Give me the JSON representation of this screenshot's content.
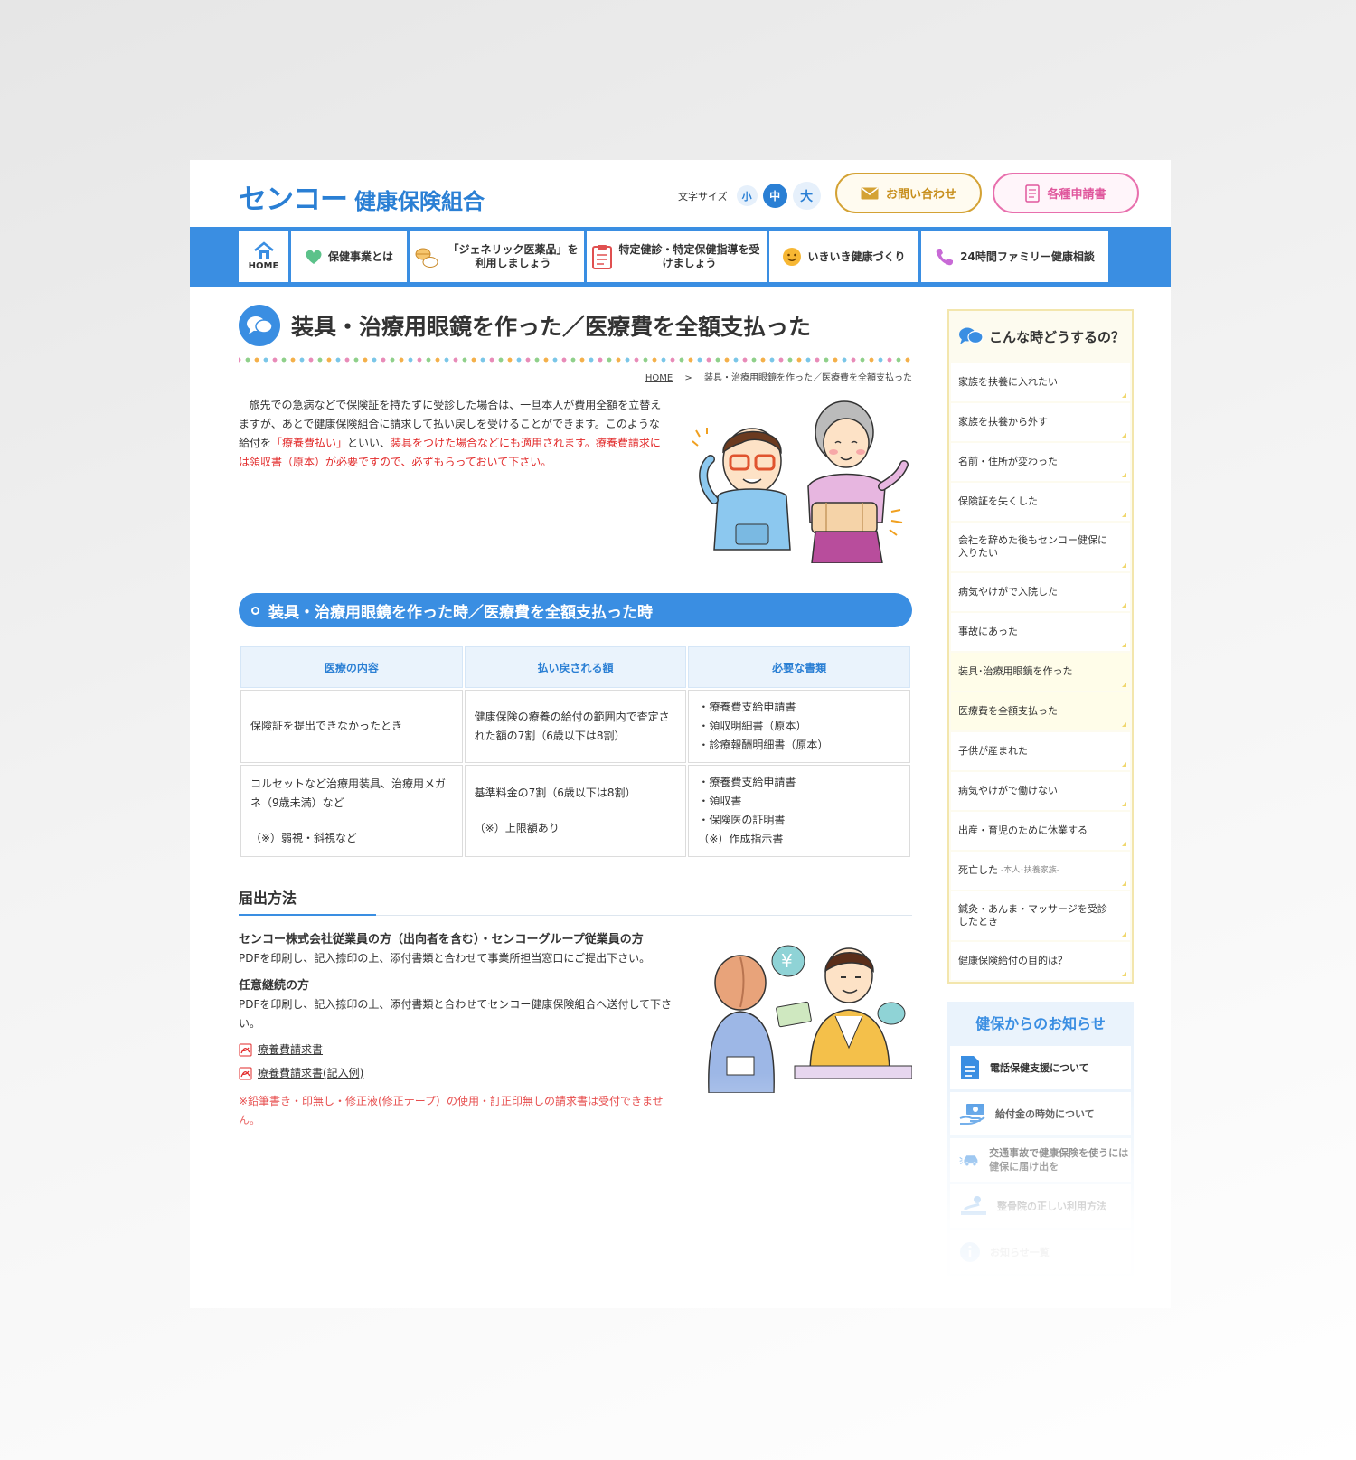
{
  "header": {
    "logo_main": "センコー",
    "logo_sub": "健康保険組合",
    "fontsize_label": "文字サイズ",
    "fontsize_small": "小",
    "fontsize_medium": "中",
    "fontsize_large": "大",
    "contact_label": "お問い合わせ",
    "forms_label": "各種申請書"
  },
  "nav": {
    "home": "HOME",
    "items": [
      "保健事業とは",
      "「ジェネリック医薬品」を利用しましょう",
      "特定健診・特定保健指導を受けましょう",
      "いきいき健康づくり",
      "24時間ファミリー健康相談"
    ]
  },
  "page": {
    "title": "装具・治療用眼鏡を作った／医療費を全額支払った",
    "breadcrumb_home": "HOME",
    "breadcrumb_sep": ">",
    "breadcrumb_current": "装具・治療用眼鏡を作った／医療費を全額支払った",
    "intro_1": "旅先での急病などで保険証を持たずに受診した場合は、一旦本人が費用全額を立替えますが、あとで健康保険組合に請求して払い戻しを受けることができます。このような給付を",
    "intro_red_1": "「療養費払い」",
    "intro_2": "といい、",
    "intro_red_2": "装具をつけた場合などにも適用されます。療養費請求には領収書（原本）が必要ですので、必ずもらっておいて下さい。",
    "section_title": "装具・治療用眼鏡を作った時／医療費を全額支払った時"
  },
  "table": {
    "headers": [
      "医療の内容",
      "払い戻される額",
      "必要な書類"
    ],
    "rows": [
      {
        "content": "保険証を提出できなかったとき",
        "amount": "健康保険の療養の給付の範囲内で査定された額の7割（6歳以下は8割）",
        "docs": [
          "・療養費支給申請書",
          "・領収明細書（原本）",
          "・診療報酬明細書（原本）"
        ]
      },
      {
        "content": "コルセットなど治療用装具、治療用メガネ（9歳未満）など",
        "content_note": "（※）弱視・斜視など",
        "amount": "基準料金の7割（6歳以下は8割）",
        "amount_note": "（※）上限額あり",
        "docs": [
          "・療養費支給申請書",
          "・領収書",
          "・保険医の証明書",
          "（※）作成指示書"
        ]
      }
    ]
  },
  "method": {
    "heading": "届出方法",
    "group1_title": "センコー株式会社従業員の方（出向者を含む）・センコーグループ従業員の方",
    "group1_text": "PDFを印刷し、記入捺印の上、添付書類と合わせて事業所担当窓口にご提出下さい。",
    "group2_title": "任意継続の方",
    "group2_text": "PDFを印刷し、記入捺印の上、添付書類と合わせてセンコー健康保険組合へ送付して下さい。",
    "link1": "療養費請求書",
    "link2": "療養費請求書(記入例)",
    "warning": "※鉛筆書き・印無し・修正液(修正テープ）の使用・訂正印無しの請求書は受付できません。"
  },
  "sidebar": {
    "title": "こんな時どうするの？",
    "items": [
      "家族を扶養に入れたい",
      "家族を扶養から外す",
      "名前・住所が変わった",
      "保険証を失くした",
      "会社を辞めた後もセンコー健保に入りたい",
      "病気やけがで入院した",
      "事故にあった",
      "装具･治療用眼鏡を作った",
      "医療費を全額支払った",
      "子供が産まれた",
      "病気やけがで働けない",
      "出産・育児のために休業する",
      "死亡した",
      "鍼灸・あんま・マッサージを受診したとき",
      "健康保険給付の目的は？"
    ],
    "death_note": "-本人･扶養家族-"
  },
  "news": {
    "title": "健保からのお知らせ",
    "items": [
      "電話保健支援について",
      "給付金の時効について",
      "交通事故で健康保険を使うには健保に届け出を",
      "整骨院の正しい利用方法",
      "お知らせ一覧"
    ]
  },
  "colors": {
    "brand_blue": "#3a8ee2",
    "accent_gold": "#d4a234",
    "accent_pink": "#e86fad",
    "warning_red": "#e22a2a"
  }
}
